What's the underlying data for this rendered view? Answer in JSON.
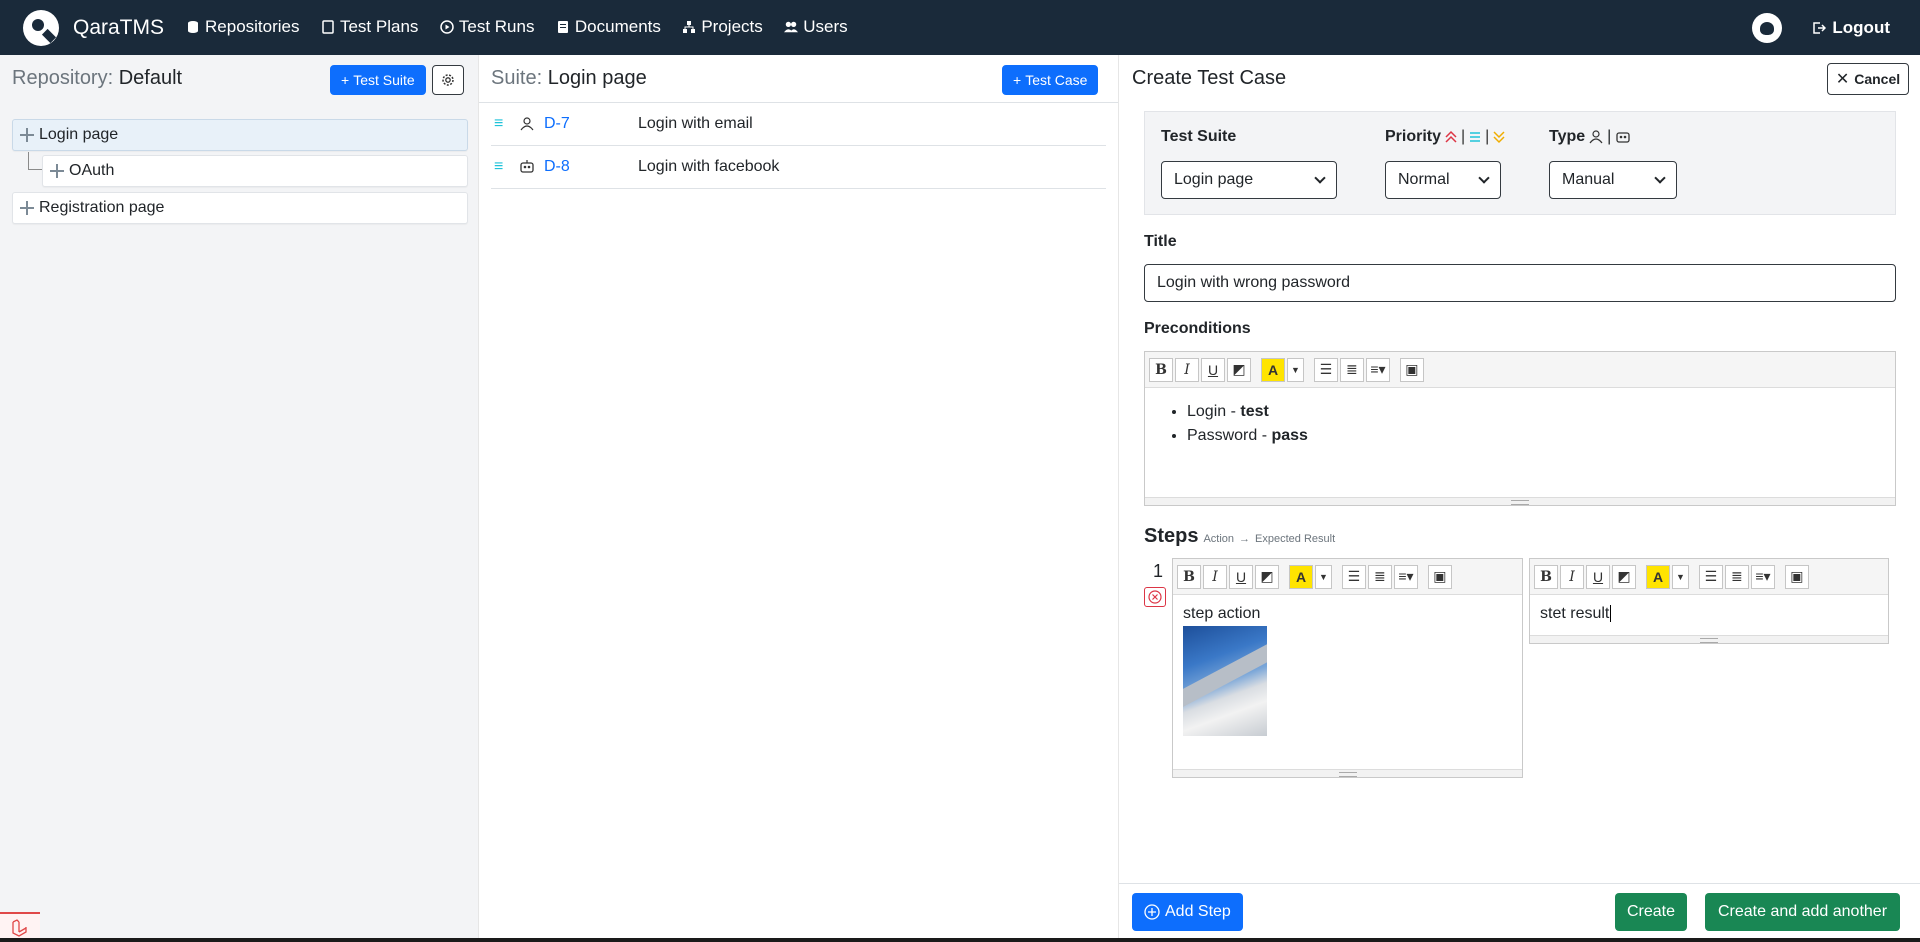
{
  "app": {
    "brand": "QaraTMS"
  },
  "nav": {
    "items": [
      {
        "label": "Repositories"
      },
      {
        "label": "Test Plans"
      },
      {
        "label": "Test Runs"
      },
      {
        "label": "Documents"
      },
      {
        "label": "Projects"
      },
      {
        "label": "Users"
      }
    ],
    "logout": "Logout"
  },
  "repository": {
    "label": "Repository:",
    "name": "Default",
    "add_suite": "Test Suite",
    "tree": [
      {
        "label": "Login page"
      },
      {
        "label": "OAuth"
      },
      {
        "label": "Registration page"
      }
    ]
  },
  "suite": {
    "label": "Suite:",
    "name": "Login page",
    "add_case": "Test Case",
    "cases": [
      {
        "id": "D-7",
        "title": "Login with email",
        "type_icon": "person-icon"
      },
      {
        "id": "D-8",
        "title": "Login with facebook",
        "type_icon": "robot-icon"
      }
    ]
  },
  "form": {
    "title": "Create Test Case",
    "cancel": "Cancel",
    "suite_label": "Test Suite",
    "suite_value": "Login page",
    "priority_label": "Priority",
    "priority_value": "Normal",
    "type_label": "Type",
    "type_value": "Manual",
    "title_label": "Title",
    "title_value": "Login with wrong password",
    "preconditions_label": "Preconditions",
    "preconditions": [
      {
        "prefix": "Login - ",
        "value": "test"
      },
      {
        "prefix": "Password - ",
        "value": "pass"
      }
    ],
    "steps_label": "Steps",
    "steps_hint_action": "Action",
    "steps_hint_result": "Expected Result",
    "step_number": "1",
    "step_action": "step action",
    "step_result": "stet result",
    "add_step": "Add Step",
    "create": "Create",
    "create_another": "Create and add another"
  },
  "colors": {
    "topbar": "#1a2a3a",
    "primary": "#0d6efd",
    "success": "#198754",
    "danger": "#dc3545",
    "priority_high": "#dc3545",
    "priority_normal": "#20c3d9",
    "priority_low": "#f0ad00"
  }
}
